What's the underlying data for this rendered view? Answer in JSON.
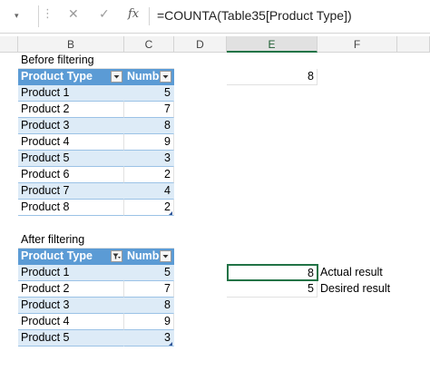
{
  "formula_bar": {
    "name_box_arrow": "▾",
    "cancel_icon": "✕",
    "enter_icon": "✓",
    "fx_label": "fx",
    "formula": "=COUNTA(Table35[Product Type])"
  },
  "columns": [
    "B",
    "C",
    "D",
    "E",
    "F"
  ],
  "before": {
    "title": "Before filtering",
    "header": [
      "Product Type",
      "Numbe"
    ],
    "rows": [
      [
        "Product 1",
        "5"
      ],
      [
        "Product 2",
        "7"
      ],
      [
        "Product 3",
        "8"
      ],
      [
        "Product 4",
        "9"
      ],
      [
        "Product 5",
        "3"
      ],
      [
        "Product 6",
        "2"
      ],
      [
        "Product 7",
        "4"
      ],
      [
        "Product 8",
        "2"
      ]
    ]
  },
  "after": {
    "title": "After filtering",
    "header": [
      "Product Type",
      "Numbe"
    ],
    "rows": [
      [
        "Product 1",
        "5"
      ],
      [
        "Product 2",
        "7"
      ],
      [
        "Product 3",
        "8"
      ],
      [
        "Product 4",
        "9"
      ],
      [
        "Product 5",
        "3"
      ]
    ]
  },
  "results": {
    "top_value": "8",
    "actual_value": "8",
    "actual_label": "Actual result",
    "desired_value": "5",
    "desired_label": "Desired result"
  },
  "colors": {
    "table_header": "#5b9bd5",
    "band": "#ddebf7",
    "selection": "#217346"
  }
}
